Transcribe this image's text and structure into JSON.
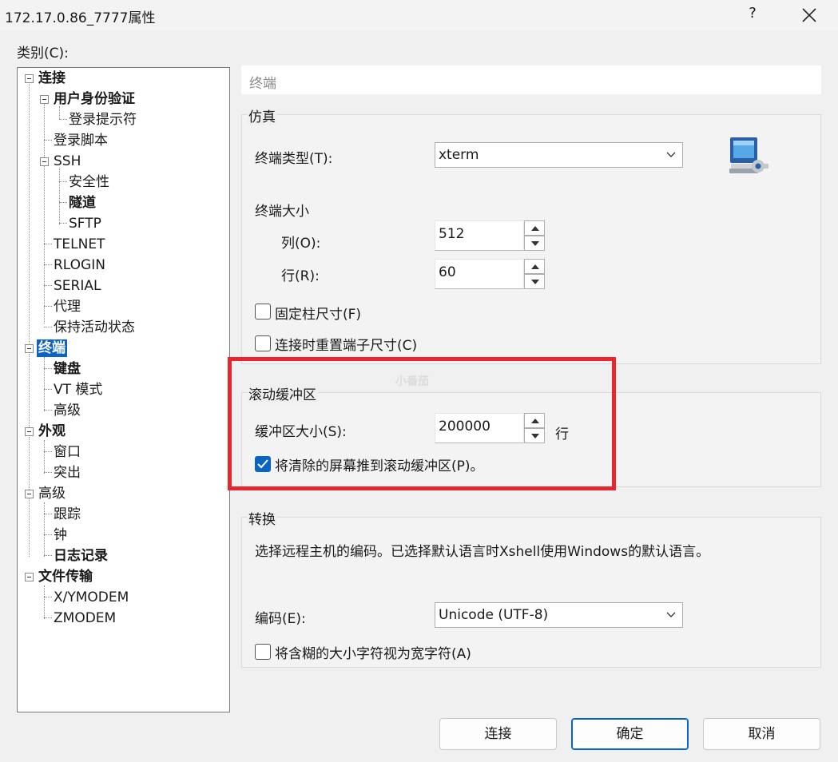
{
  "window": {
    "title": "172.17.0.86_7777属性",
    "help": "?"
  },
  "category_label": "类别(C):",
  "tree": {
    "connection": "连接",
    "auth": "用户身份验证",
    "login_prompt": "登录提示符",
    "login_script": "登录脚本",
    "ssh": "SSH",
    "security": "安全性",
    "tunnel": "隧道",
    "sftp": "SFTP",
    "telnet": "TELNET",
    "rlogin": "RLOGIN",
    "serial": "SERIAL",
    "proxy": "代理",
    "keepalive": "保持活动状态",
    "terminal": "终端",
    "keyboard": "键盘",
    "vt_mode": "VT 模式",
    "terminal_advanced": "高级",
    "appearance": "外观",
    "window": "窗口",
    "highlight": "突出",
    "advanced": "高级",
    "trace": "跟踪",
    "bell": "钟",
    "logging": "日志记录",
    "file_transfer": "文件传输",
    "xymodem": "X/YMODEM",
    "zmodem": "ZMODEM"
  },
  "header": {
    "title": "终端"
  },
  "emulation": {
    "group_title": "仿真",
    "terminal_type_label": "终端类型(T):",
    "terminal_type_value": "xterm",
    "terminal_size_label": "终端大小",
    "columns_label": "列(O):",
    "columns_value": "512",
    "rows_label": "行(R):",
    "rows_value": "60",
    "fixed_size_label": "固定柱尺寸(F)",
    "fixed_size_checked": false,
    "reset_on_connect_label": "连接时重置端子尺寸(C)",
    "reset_on_connect_checked": false
  },
  "scroll_buffer": {
    "group_title": "滚动缓冲区",
    "size_label": "缓冲区大小(S):",
    "size_value": "200000",
    "unit": "行",
    "push_cleared_label": "将清除的屏幕推到滚动缓冲区(P)。",
    "push_cleared_checked": true
  },
  "translation": {
    "group_title": "转换",
    "description": "选择远程主机的编码。已选择默认语言时Xshell使用Windows的默认语言。",
    "encoding_label": "编码(E):",
    "encoding_value": "Unicode (UTF-8)",
    "ambiguous_label": "将含糊的大小字符视为宽字符(A)",
    "ambiguous_checked": false
  },
  "buttons": {
    "connect": "连接",
    "ok": "确定",
    "cancel": "取消"
  },
  "watermark": "小番茄",
  "colors": {
    "accent": "#0a64c8",
    "highlight_box": "#e8262d"
  }
}
